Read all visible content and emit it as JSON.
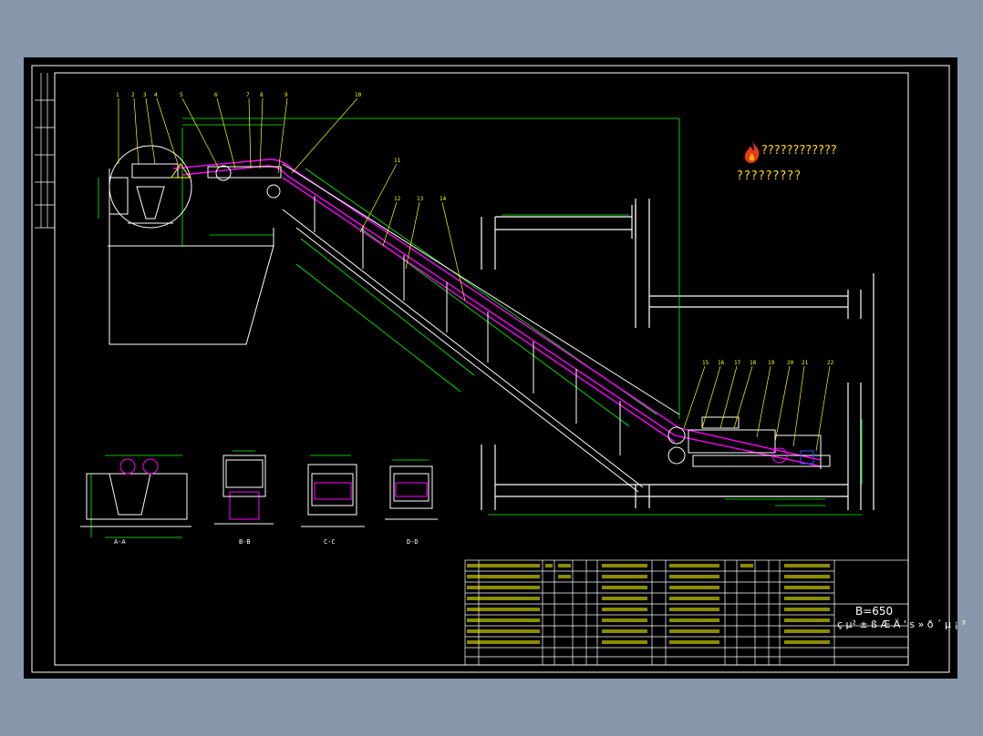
{
  "drawing": {
    "spec_title": "B=650",
    "spec_subtitle": "ç µ² ± ß Æ Ä ' s » ð ´ µ ¡ ³",
    "watermark_line1": "????????????",
    "watermark_line2": "?????????",
    "section_labels": [
      "A-A",
      "B-B",
      "C-C",
      "D-D"
    ],
    "callouts": [
      "1",
      "2",
      "3",
      "4",
      "5",
      "6",
      "7",
      "8",
      "9",
      "10",
      "11",
      "12",
      "13",
      "14",
      "15",
      "16",
      "17",
      "18",
      "19",
      "20",
      "21",
      "22"
    ]
  },
  "colors": {
    "background": "#000000",
    "frame": "#ffffff",
    "dimension": "#00ff00",
    "belt": "#ff00ff",
    "structure": "#ffffff",
    "annotation": "#ffff00",
    "watermark": "#ffd600"
  }
}
